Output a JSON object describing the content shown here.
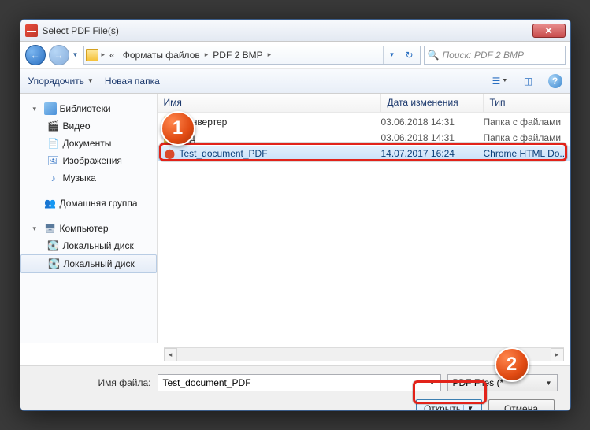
{
  "window": {
    "title": "Select PDF File(s)"
  },
  "breadcrumb": {
    "root": "«",
    "items": [
      "Форматы файлов",
      "PDF 2 BMP"
    ]
  },
  "search": {
    "placeholder": "Поиск: PDF 2 BMP"
  },
  "toolbar": {
    "organize": "Упорядочить",
    "new_folder": "Новая папка"
  },
  "sidebar": {
    "libraries": "Библиотеки",
    "video": "Видео",
    "documents": "Документы",
    "images": "Изображения",
    "music": "Музыка",
    "homegroup": "Домашняя группа",
    "computer": "Компьютер",
    "disk1": "Локальный диск",
    "disk2": "Локальный диск"
  },
  "columns": {
    "name": "Имя",
    "date": "Дата изменения",
    "type": "Тип"
  },
  "rows": [
    {
      "name": "КОнвертер",
      "date": "03.06.2018 14:31",
      "type": "Папка с файлами",
      "kind": "folder"
    },
    {
      "name": "ард",
      "date": "03.06.2018 14:31",
      "type": "Папка с файлами",
      "kind": "folder"
    },
    {
      "name": "Test_document_PDF",
      "date": "14.07.2017 16:24",
      "type": "Chrome HTML Do...",
      "kind": "file"
    }
  ],
  "footer": {
    "filename_label": "Имя файла:",
    "filename_value": "Test_document_PDF",
    "filter": "PDF Files (*",
    "open": "Открыть",
    "cancel": "Отмена"
  },
  "annotations": {
    "badge1": "1",
    "badge2": "2"
  }
}
